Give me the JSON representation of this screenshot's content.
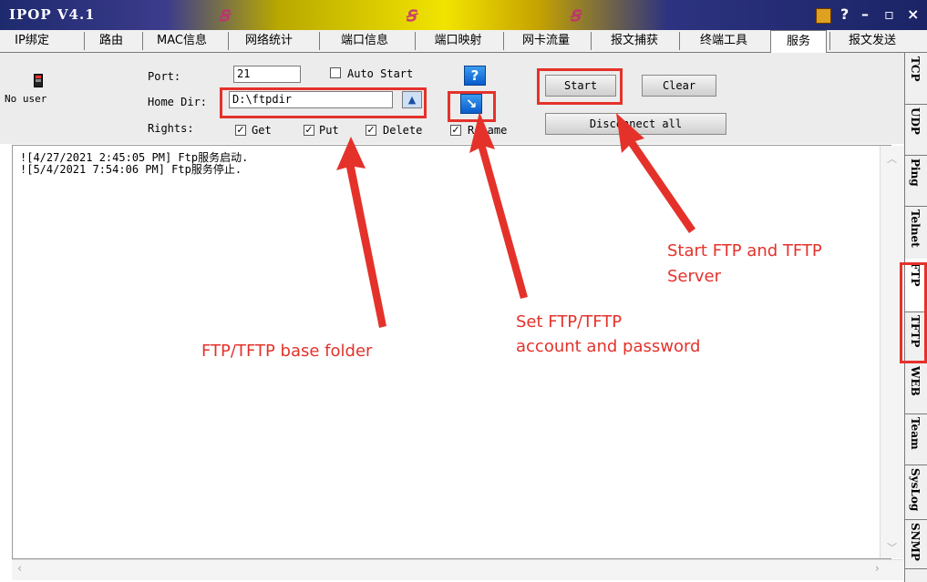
{
  "window": {
    "title": "IPOP V4.1",
    "controls": {
      "help": "?",
      "minimize": "–",
      "maximize": "▫",
      "close": "×"
    }
  },
  "tabs": [
    {
      "label": "IP绑定"
    },
    {
      "label": "路由"
    },
    {
      "label": "MAC信息"
    },
    {
      "label": "网络统计"
    },
    {
      "label": "端口信息"
    },
    {
      "label": "端口映射"
    },
    {
      "label": "网卡流量"
    },
    {
      "label": "报文捕获"
    },
    {
      "label": "终端工具"
    },
    {
      "label": "服务",
      "active": true
    },
    {
      "label": "报文发送"
    }
  ],
  "ftp": {
    "status": "No user",
    "port_label": "Port:",
    "port_value": "21",
    "auto_start_label": "Auto Start",
    "auto_start_checked": false,
    "home_dir_label": "Home Dir:",
    "home_dir_value": "D:\\ftpdir",
    "rights_label": "Rights:",
    "rights": [
      {
        "label": "Get",
        "checked": true
      },
      {
        "label": "Put",
        "checked": true
      },
      {
        "label": "Delete",
        "checked": true
      },
      {
        "label": "Rename",
        "checked": true
      }
    ],
    "help_glyph": "?",
    "account_glyph": "↘",
    "start_label": "Start",
    "clear_label": "Clear",
    "disconnect_label": "Disconnect all"
  },
  "log": {
    "lines": [
      "![4/27/2021 2:45:05 PM] Ftp服务启动.",
      "![5/4/2021 7:54:06 PM] Ftp服务停止."
    ]
  },
  "side_tabs": [
    {
      "label": "TCP"
    },
    {
      "label": "UDP"
    },
    {
      "label": "Ping"
    },
    {
      "label": "Telnet"
    },
    {
      "label": "FTP",
      "active": true
    },
    {
      "label": "TFTP"
    },
    {
      "label": "WEB"
    },
    {
      "label": "Team"
    },
    {
      "label": "SysLog"
    },
    {
      "label": "SNMP"
    }
  ],
  "annotations": {
    "start_server": "Start FTP and TFTP\nServer",
    "account": "Set FTP/TFTP\naccount and password",
    "base_folder": "FTP/TFTP base folder"
  },
  "colors": {
    "annotation": "#e4322b",
    "title_bar": "#1e2a6e",
    "accent": "#0a5ccc"
  }
}
